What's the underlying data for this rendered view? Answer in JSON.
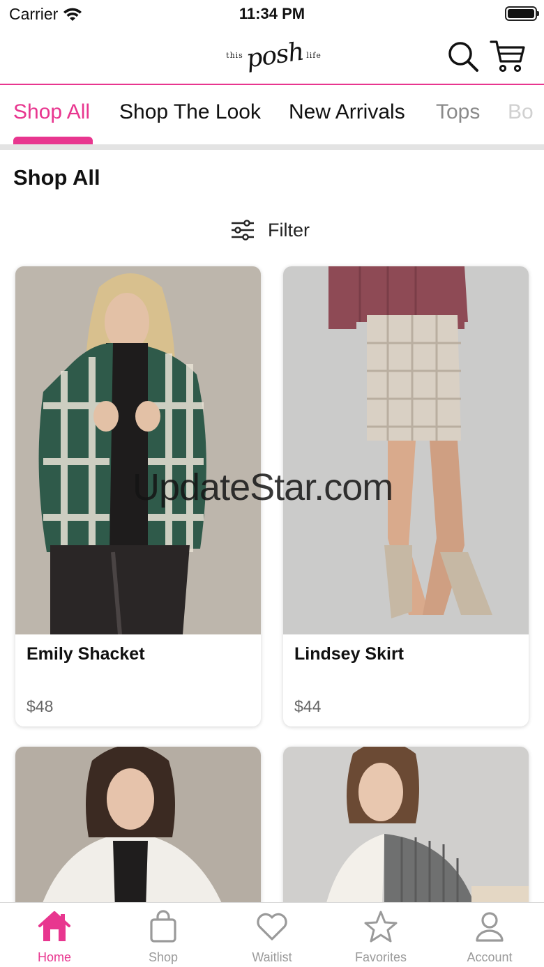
{
  "status_bar": {
    "carrier": "Carrier",
    "time": "11:34 PM"
  },
  "header": {
    "logo_small_left": "this",
    "logo_script": "posh",
    "logo_small_right": "life",
    "icons": [
      "search-icon",
      "cart-icon"
    ]
  },
  "tabs": [
    {
      "label": "Shop All",
      "active": true
    },
    {
      "label": "Shop The Look",
      "active": false
    },
    {
      "label": "New Arrivals",
      "active": false
    },
    {
      "label": "Tops",
      "active": false
    },
    {
      "label": "Bo",
      "active": false
    }
  ],
  "section": {
    "title": "Shop All"
  },
  "filter": {
    "label": "Filter",
    "icon": "sliders-icon"
  },
  "products": [
    {
      "name": "Emily Shacket",
      "price": "$48",
      "image": "woman in green plaid shacket and black leather pants"
    },
    {
      "name": "Lindsey Skirt",
      "price": "$44",
      "image": "woman in tweed mini skirt, mauve sweater and taupe boots"
    },
    {
      "name": "",
      "price": "",
      "image": "woman in white faux fur jacket"
    },
    {
      "name": "",
      "price": "",
      "image": "woman in white and grey corduroy colorblock shirt"
    }
  ],
  "watermark": "UpdateStar.com",
  "bottom_nav": [
    {
      "label": "Home",
      "icon": "home-icon",
      "active": true
    },
    {
      "label": "Shop",
      "icon": "shopping-bag-icon",
      "active": false
    },
    {
      "label": "Waitlist",
      "icon": "heart-icon",
      "active": false
    },
    {
      "label": "Favorites",
      "icon": "star-icon",
      "active": false
    },
    {
      "label": "Account",
      "icon": "user-icon",
      "active": false
    }
  ],
  "colors": {
    "accent": "#e8368f",
    "inactive": "#9a9a9a"
  }
}
